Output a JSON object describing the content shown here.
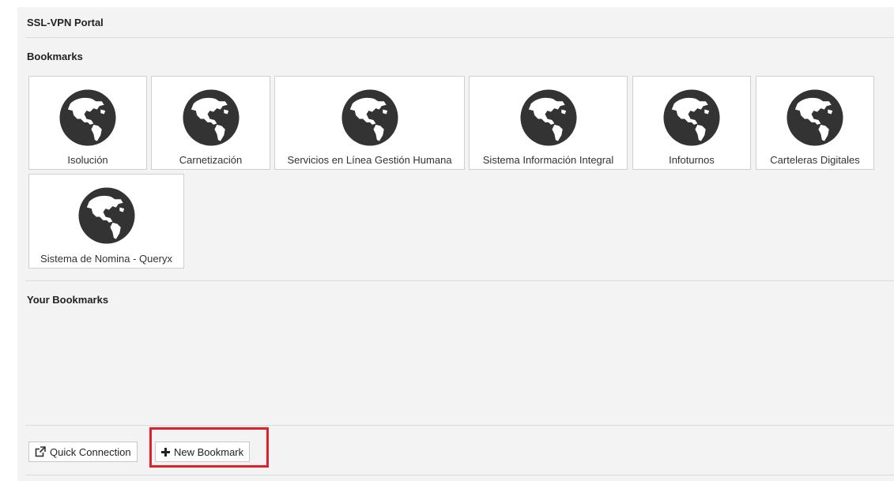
{
  "header": {
    "title": "SSL-VPN Portal"
  },
  "bookmarks": {
    "title": "Bookmarks",
    "items": [
      {
        "label": "Isolución",
        "icon": "globe-icon"
      },
      {
        "label": "Carnetización",
        "icon": "globe-icon"
      },
      {
        "label": "Servicios en Línea Gestión Humana",
        "icon": "globe-icon"
      },
      {
        "label": "Sistema Información Integral",
        "icon": "globe-icon"
      },
      {
        "label": "Infoturnos",
        "icon": "globe-icon"
      },
      {
        "label": "Carteleras Digitales",
        "icon": "globe-icon"
      },
      {
        "label": "Sistema de Nomina - Queryx",
        "icon": "globe-icon"
      }
    ]
  },
  "your_bookmarks": {
    "title": "Your Bookmarks"
  },
  "toolbar": {
    "quick_connection_label": "Quick Connection",
    "quick_connection_icon": "external-link-icon",
    "new_bookmark_label": "New Bookmark",
    "new_bookmark_icon": "plus-icon"
  },
  "colors": {
    "highlight": "#e0202a",
    "globe": "#333333",
    "panel_background": "#f3f3f3"
  }
}
